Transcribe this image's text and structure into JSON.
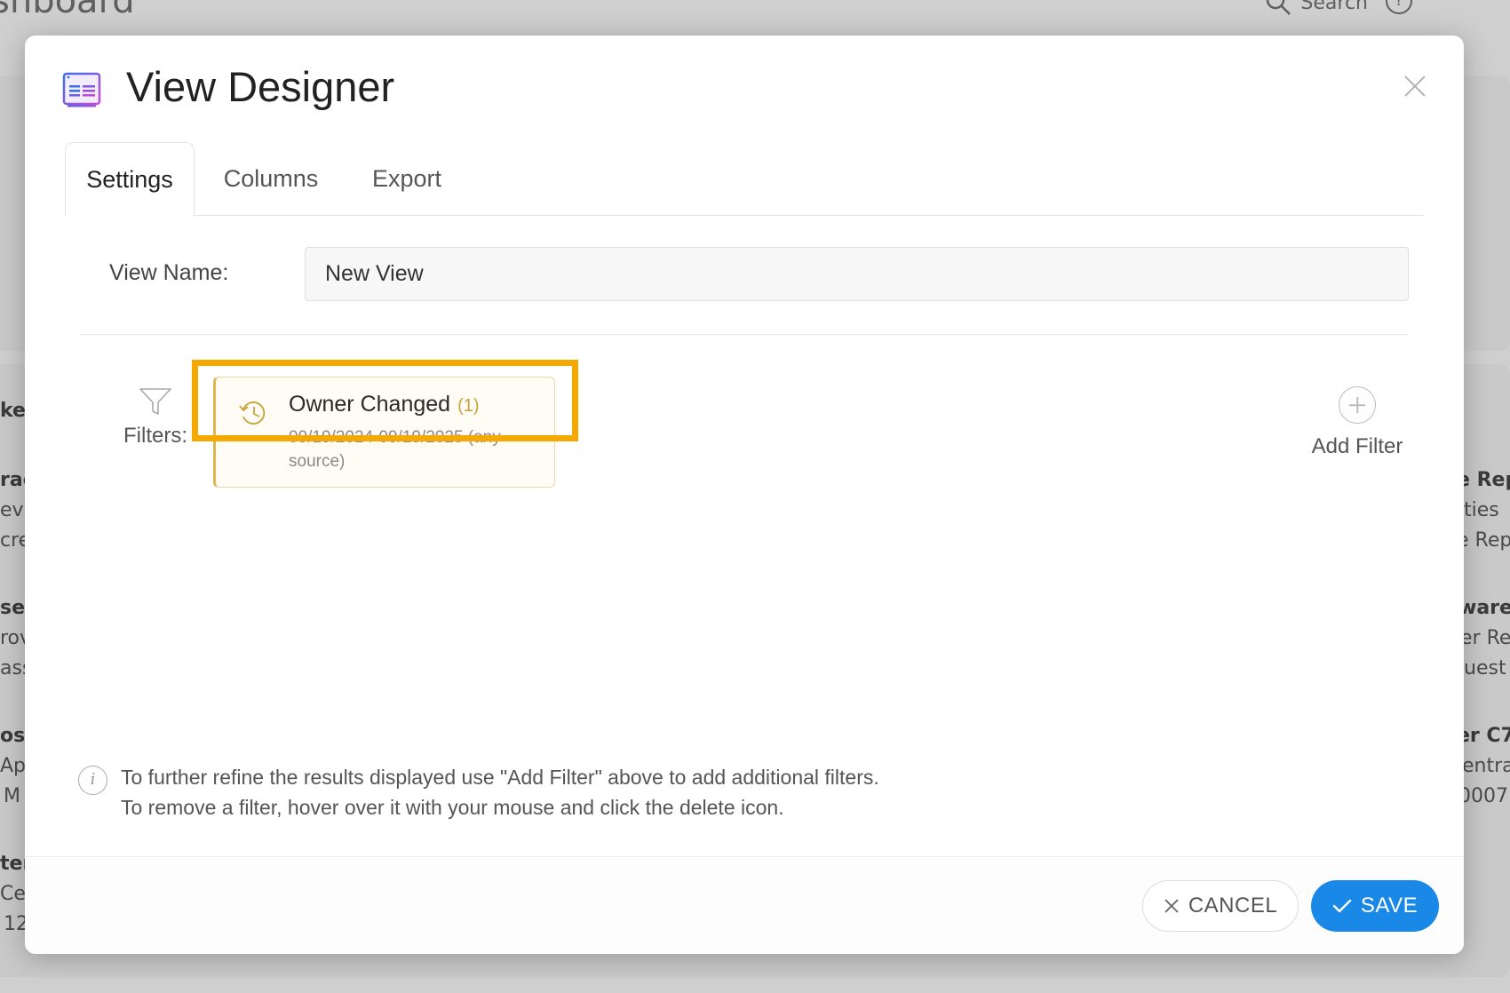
{
  "background": {
    "title": "shboard",
    "search_label": "Search",
    "help_glyph": "?",
    "left_fragments": [
      "ket",
      "rac",
      "evi",
      "cre",
      "set",
      "rov",
      "ass",
      "osy",
      "Ap",
      "M",
      "ter",
      "Ce",
      "12"
    ],
    "right_fragments": [
      "e Rep",
      "ties",
      "e Rep",
      "ware",
      "er Re",
      "uest",
      "er C7",
      "entra",
      "0007"
    ]
  },
  "modal": {
    "title": "View Designer",
    "icon": "view-designer-icon",
    "close_icon": "close-icon",
    "tabs": [
      {
        "label": "Settings",
        "active": true
      },
      {
        "label": "Columns",
        "active": false
      },
      {
        "label": "Export",
        "active": false
      }
    ],
    "view_name": {
      "label": "View Name:",
      "value": "New View"
    },
    "filters": {
      "label": "Filters:",
      "icon": "funnel-icon",
      "items": [
        {
          "title": "Owner Changed",
          "count": "(1)",
          "subtitle": "09/19/2024-09/19/2025 (any source)",
          "icon": "history-icon"
        }
      ],
      "add_label": "Add Filter",
      "add_icon": "plus-circle-icon"
    },
    "info": {
      "line1": "To further refine the results displayed use \"Add Filter\" above to add additional filters.",
      "line2": "To remove a filter, hover over it with your mouse and click the delete icon."
    },
    "footer": {
      "cancel_label": "CANCEL",
      "save_label": "SAVE"
    }
  },
  "colors": {
    "accent_blue": "#1a88e6",
    "highlight_orange": "#f5a800",
    "chip_gold": "#c9a23a"
  }
}
